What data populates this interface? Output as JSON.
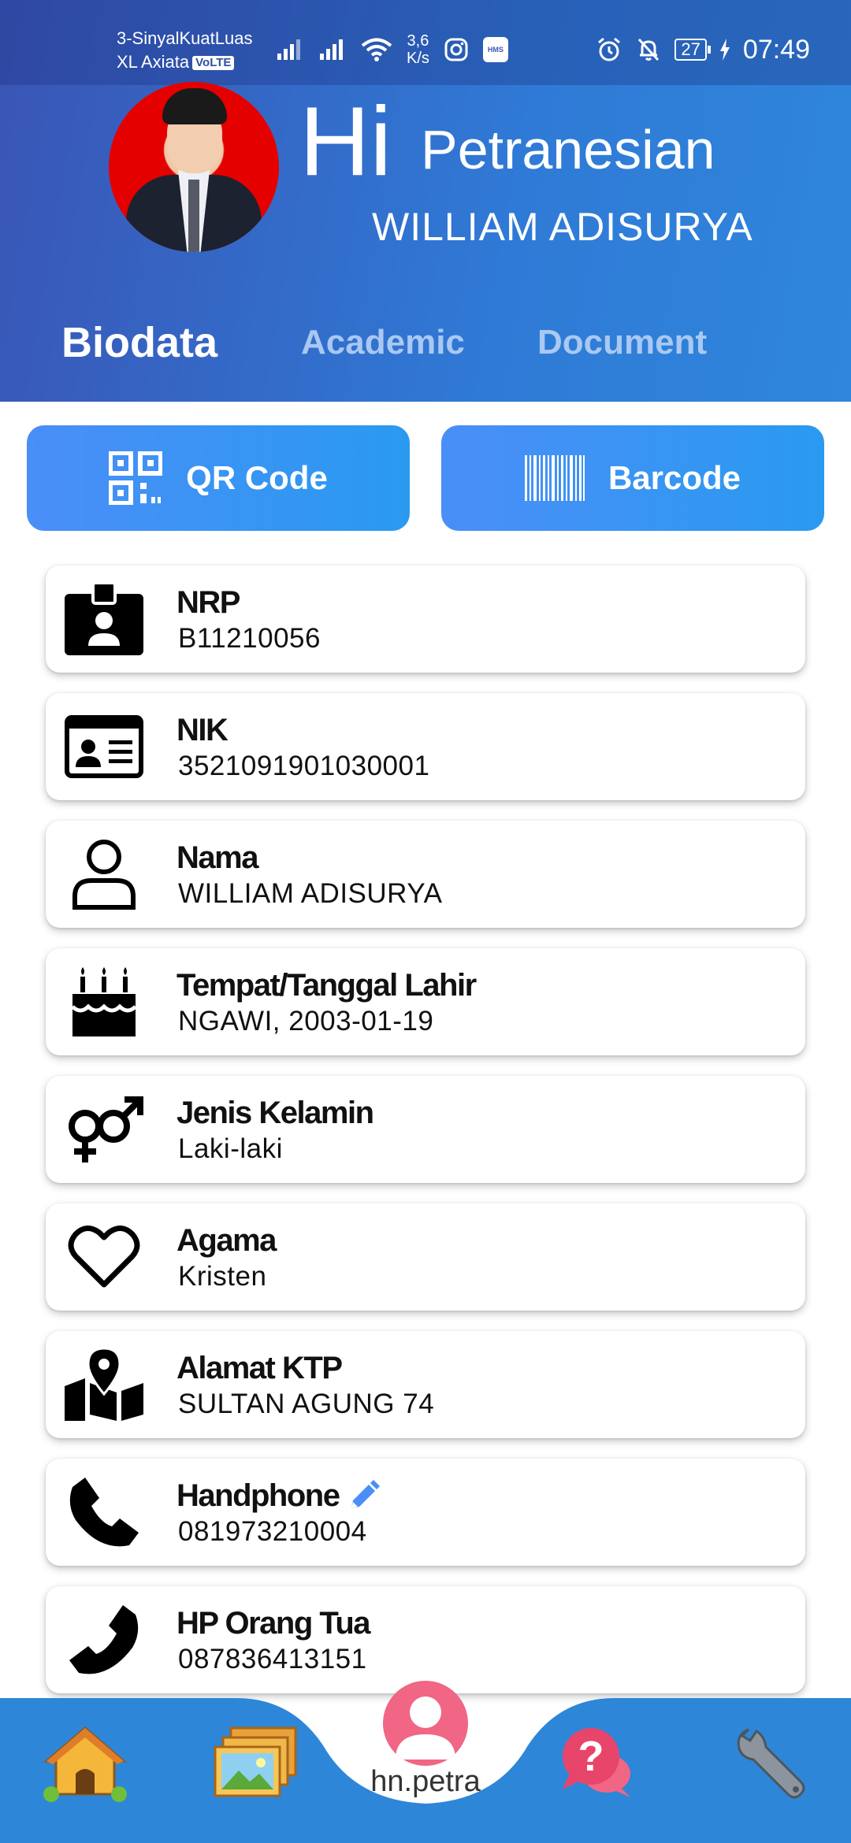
{
  "status_bar": {
    "carrier_line1": "3-SinyalKuatLuas",
    "carrier_line2": "XL Axiata",
    "volte": "VoLTE",
    "net_speed_value": "3,6",
    "net_speed_unit": "K/s",
    "hms_badge": "HMS",
    "battery": "27",
    "time": "07:49"
  },
  "greeting": {
    "hi": "Hi",
    "subtitle": "Petranesian",
    "user_name": "WILLIAM ADISURYA"
  },
  "tabs": [
    {
      "label": "Biodata",
      "active": true
    },
    {
      "label": "Academic",
      "active": false
    },
    {
      "label": "Document",
      "active": false
    }
  ],
  "buttons": {
    "qr_label": "QR Code",
    "barcode_label": "Barcode"
  },
  "fields": [
    {
      "icon": "id-badge-icon",
      "label": "NRP",
      "value": "B11210056"
    },
    {
      "icon": "id-card-icon",
      "label": "NIK",
      "value": "3521091901030001"
    },
    {
      "icon": "user-icon",
      "label": "Nama",
      "value": "WILLIAM ADISURYA"
    },
    {
      "icon": "birthday-cake-icon",
      "label": "Tempat/Tanggal Lahir",
      "value": "NGAWI, 2003-01-19"
    },
    {
      "icon": "gender-icon",
      "label": "Jenis Kelamin",
      "value": "Laki-laki"
    },
    {
      "icon": "heart-icon",
      "label": "Agama",
      "value": "Kristen"
    },
    {
      "icon": "map-marker-icon",
      "label": "Alamat KTP",
      "value": "SULTAN AGUNG 74"
    },
    {
      "icon": "phone-icon",
      "label": "Handphone",
      "value": "081973210004",
      "editable": true
    },
    {
      "icon": "phone-alt-icon",
      "label": "HP Orang Tua",
      "value": "087836413151"
    }
  ],
  "bottom_nav": {
    "items": [
      "home-icon",
      "gallery-icon",
      "profile-avatar",
      "help-chat-icon",
      "wrench-icon"
    ],
    "center_label": "hn.petra"
  },
  "colors": {
    "header_start": "#3a55b5",
    "header_end": "#2f86dc",
    "button_blue": "#3a92f4",
    "nav_blue": "#2e86d8",
    "edit_pencil": "#4a8ef7",
    "avatar_pink": "#f06684"
  }
}
